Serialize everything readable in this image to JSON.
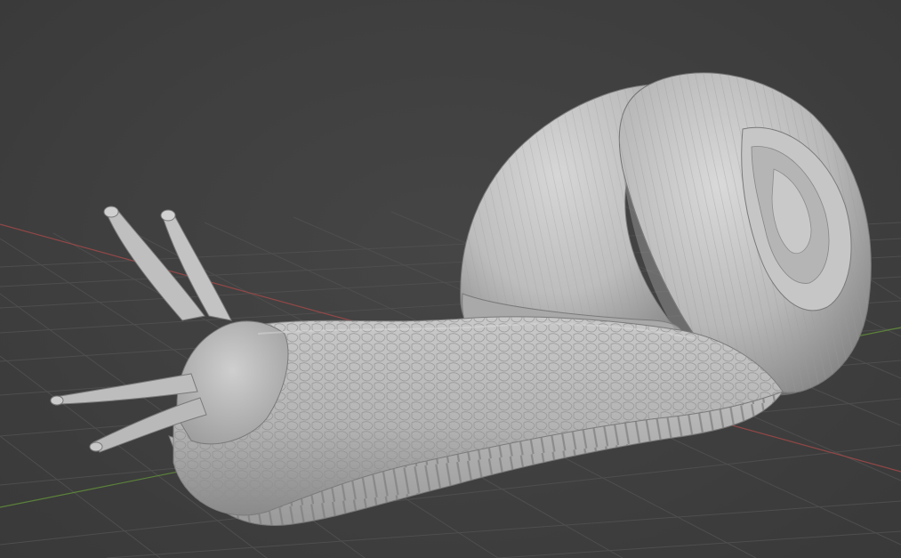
{
  "viewport": {
    "mode": "3D viewport",
    "background_color": "#3d3d3d",
    "grid_line_color": "#4e4e4e",
    "x_axis_color": "#9c4848",
    "y_axis_color": "#5f8a3a",
    "model_color": "#bdbdbd"
  },
  "scene": {
    "object_icon": "snail-sculpt-mesh-icon"
  }
}
